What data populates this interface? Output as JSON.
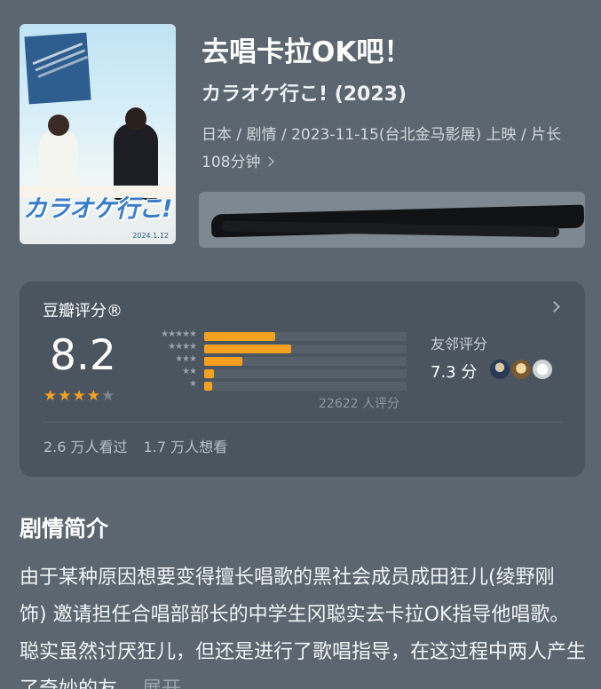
{
  "header": {
    "title_zh": "去唱卡拉OK吧！",
    "title_original": "カラオケ行こ! (2023)",
    "meta": "日本 / 剧情 / 2023-11-15(台北金马影展) 上映 / 片长108分钟",
    "poster": {
      "logo_text": "カラオケ行こ!",
      "date_text": "2024.1.12"
    }
  },
  "rating": {
    "title": "豆瓣评分®",
    "score": "8.2",
    "stars": 4,
    "distribution": [
      {
        "stars": 5,
        "fraction": 0.35
      },
      {
        "stars": 4,
        "fraction": 0.43
      },
      {
        "stars": 3,
        "fraction": 0.19
      },
      {
        "stars": 2,
        "fraction": 0.05
      },
      {
        "stars": 1,
        "fraction": 0.04
      }
    ],
    "count": "22622 人评分",
    "friends_label": "友邻评分",
    "friends_score": "7.3 分",
    "watched": "2.6 万人看过",
    "wish": "1.7 万人想看"
  },
  "synopsis": {
    "title": "剧情简介",
    "text": "由于某种原因想要变得擅长唱歌的黑社会成员成田狂儿(绫野刚 饰) 邀请担任合唱部部长的中学生冈聪实去卡拉OK指导他唱歌。聪实虽然讨厌狂儿，但还是进行了歌唱指导，在这过程中两人产生了奇妙的友...",
    "more": "展开"
  },
  "colors": {
    "background": "#5b6670",
    "card": "#4a5560",
    "star": "#f4a120"
  }
}
